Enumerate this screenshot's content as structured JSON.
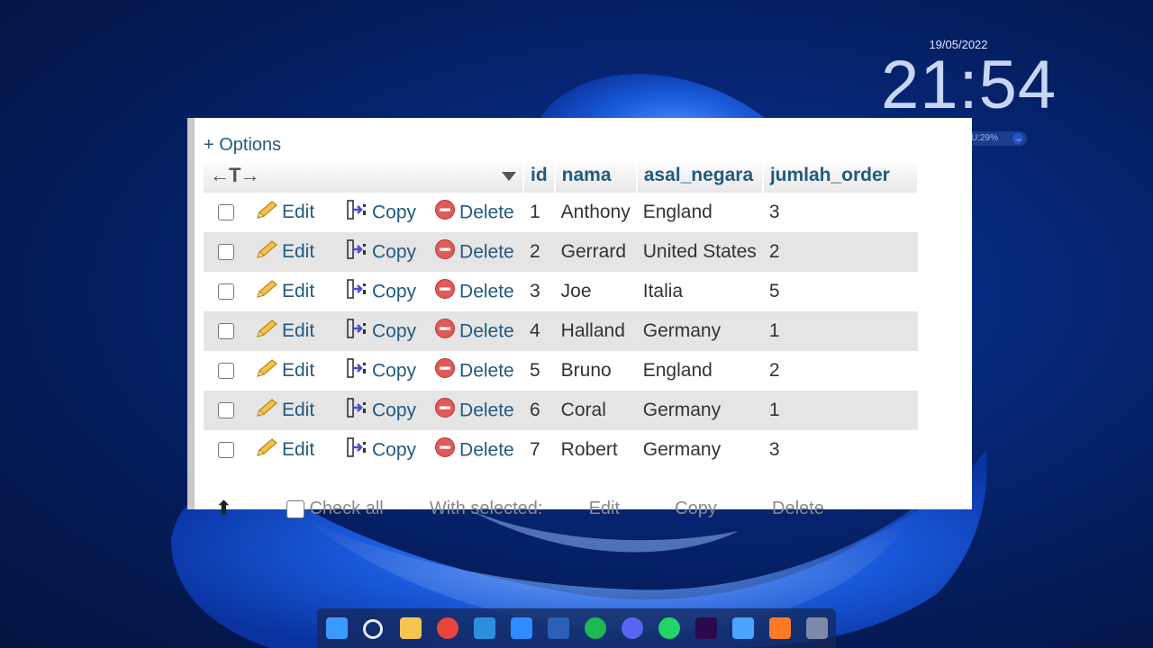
{
  "desktop": {
    "date": "19/05/2022",
    "time": "21:54",
    "cpu": "U:29%"
  },
  "panel": {
    "options_label": "+ Options",
    "columns": [
      "id",
      "nama",
      "asal_negara",
      "jumlah_order"
    ],
    "action_labels": {
      "edit": "Edit",
      "copy": "Copy",
      "delete": "Delete"
    },
    "rows": [
      {
        "id": "1",
        "nama": "Anthony",
        "asal_negara": "England",
        "jumlah_order": "3"
      },
      {
        "id": "2",
        "nama": "Gerrard",
        "asal_negara": "United States",
        "jumlah_order": "2"
      },
      {
        "id": "3",
        "nama": "Joe",
        "asal_negara": "Italia",
        "jumlah_order": "5"
      },
      {
        "id": "4",
        "nama": "Halland",
        "asal_negara": "Germany",
        "jumlah_order": "1"
      },
      {
        "id": "5",
        "nama": "Bruno",
        "asal_negara": "England",
        "jumlah_order": "2"
      },
      {
        "id": "6",
        "nama": "Coral",
        "asal_negara": "Germany",
        "jumlah_order": "1"
      },
      {
        "id": "7",
        "nama": "Robert",
        "asal_negara": "Germany",
        "jumlah_order": "3"
      }
    ],
    "footer": {
      "check_all": "Check all",
      "with_selected": "With selected:",
      "edit": "Edit",
      "copy": "Copy",
      "delete": "Delete"
    }
  },
  "taskbar": {
    "icons": [
      "windows-start-icon",
      "search-icon",
      "file-explorer-icon",
      "chrome-icon",
      "vscode-icon",
      "zoom-icon",
      "word-icon",
      "spotify-icon",
      "discord-icon",
      "whatsapp-icon",
      "premiere-icon",
      "network-icon",
      "xampp-icon",
      "calculator-icon"
    ]
  }
}
